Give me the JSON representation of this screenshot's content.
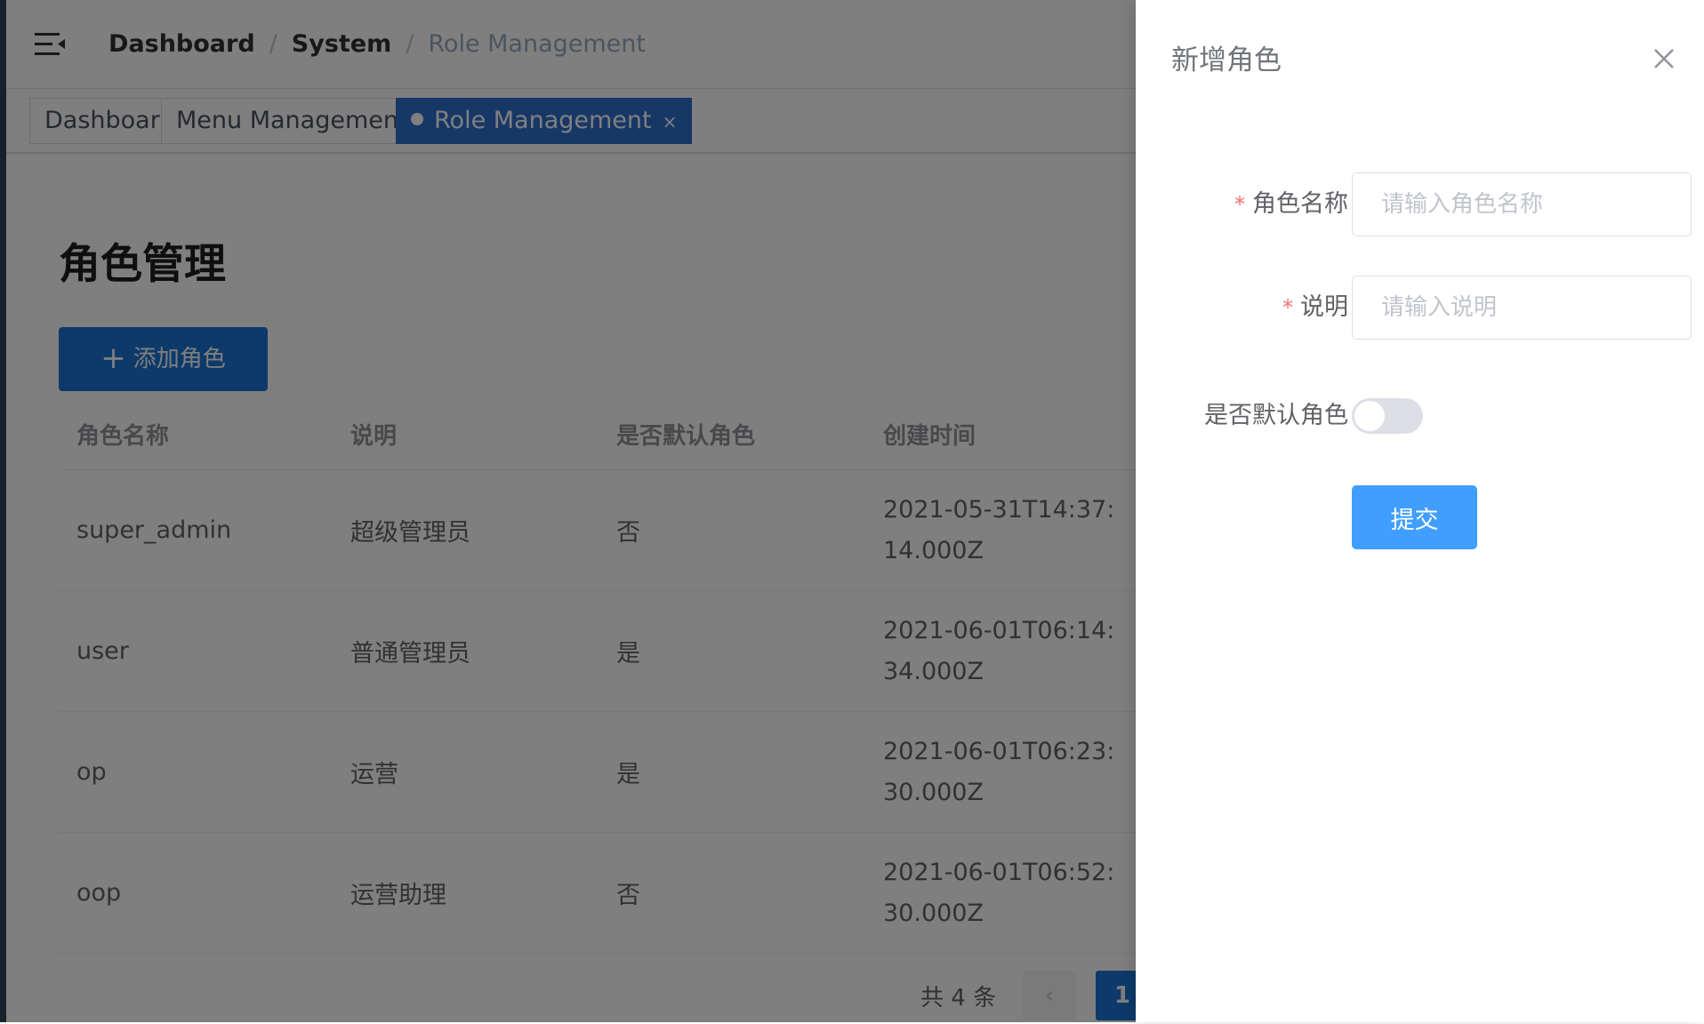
{
  "navbar": {
    "breadcrumb": [
      "Dashboard",
      "System",
      "Role Management"
    ]
  },
  "tags": [
    {
      "label": "Dashboard",
      "active": false,
      "closable": false
    },
    {
      "label": "Menu Management",
      "active": false,
      "closable": true
    },
    {
      "label": "Role Management",
      "active": true,
      "closable": true
    }
  ],
  "tag_close_glyph": "×",
  "page": {
    "title": "角色管理",
    "add_button": "添加角色",
    "add_button_icon": "plus-icon"
  },
  "table": {
    "columns": [
      "角色名称",
      "说明",
      "是否默认角色",
      "创建时间"
    ],
    "rows": [
      {
        "name": "super_admin",
        "desc": "超级管理员",
        "is_default": "否",
        "created": "2021-05-31T14:37:14.000Z"
      },
      {
        "name": "user",
        "desc": "普通管理员",
        "is_default": "是",
        "created": "2021-06-01T06:14:34.000Z"
      },
      {
        "name": "op",
        "desc": "运营",
        "is_default": "是",
        "created": "2021-06-01T06:23:30.000Z"
      },
      {
        "name": "oop",
        "desc": "运营助理",
        "is_default": "否",
        "created": "2021-06-01T06:52:30.000Z"
      }
    ]
  },
  "pagination": {
    "total": "共 4 条",
    "prev_glyph": "‹",
    "current_page": "1"
  },
  "drawer": {
    "title": "新增角色",
    "fields": {
      "role_name": {
        "label": "角色名称",
        "placeholder": "请输入角色名称",
        "required": true,
        "value": ""
      },
      "description": {
        "label": "说明",
        "placeholder": "请输入说明",
        "required": true,
        "value": ""
      },
      "is_default": {
        "label": "是否默认角色",
        "checked": false
      }
    },
    "required_mark": "*",
    "submit_label": "提交"
  },
  "colors": {
    "primary": "#1a74d6",
    "submit": "#409eff",
    "sidebar": "#304156",
    "required": "#f56c6c"
  }
}
